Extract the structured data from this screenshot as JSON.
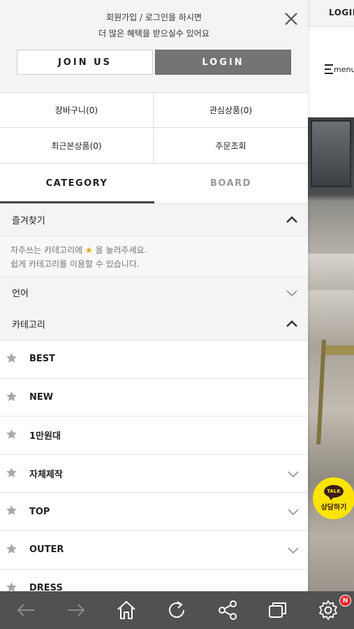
{
  "background_page": {
    "top_login": "LOGIN",
    "menu_label": "menu"
  },
  "kakao_talk": {
    "bubble_text": "TALK",
    "label": "상담하기",
    "color": "#fde400"
  },
  "drawer": {
    "login_message_line1": "회원가입 / 로그인을 하시면",
    "login_message_line2": "더 많은 혜택을 받으실수 있어요",
    "join_label": "JOIN US",
    "login_label": "LOGIN",
    "quick_links": [
      "장바구니(0)",
      "관심상품(0)",
      "최근본상품(0)",
      "주문조회"
    ],
    "tabs": [
      {
        "label": "CATEGORY",
        "active": true
      },
      {
        "label": "BOARD",
        "active": false
      }
    ],
    "favorites": {
      "title": "즐겨찾기",
      "help_part1": "자주쓰는 카테고리에",
      "help_part2": "을 눌러주세요.",
      "help_line2": "쉽게 카테고리를 이용할 수 있습니다.",
      "expanded": true
    },
    "language": {
      "title": "언어",
      "expanded": false
    },
    "category": {
      "title": "카테고리",
      "expanded": true
    },
    "categories": [
      {
        "label": "BEST",
        "has_children": false
      },
      {
        "label": "NEW",
        "has_children": false
      },
      {
        "label": "1만원대",
        "has_children": false
      },
      {
        "label": "자체제작",
        "has_children": true
      },
      {
        "label": "TOP",
        "has_children": true
      },
      {
        "label": "OUTER",
        "has_children": true
      },
      {
        "label": "DRESS",
        "has_children": false
      }
    ]
  },
  "bottom_bar": {
    "icons": [
      "back-icon",
      "forward-icon",
      "home-icon",
      "refresh-icon",
      "share-icon",
      "tabs-icon",
      "settings-icon"
    ],
    "notification_badge": "N",
    "badge_color": "#e8262b"
  }
}
